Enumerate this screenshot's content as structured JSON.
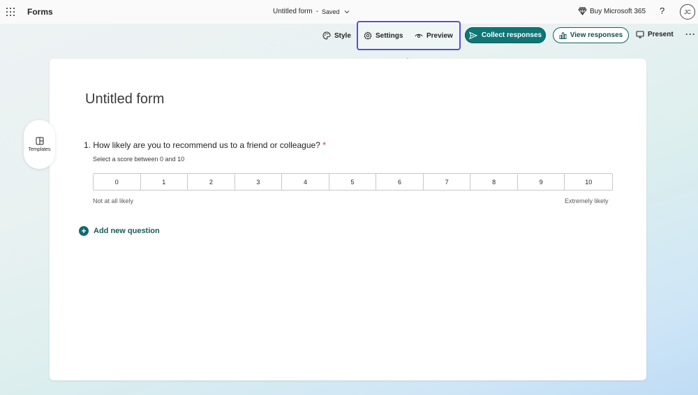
{
  "topbar": {
    "app_name": "Forms",
    "doc_title": "Untitled form",
    "separator": "-",
    "status": "Saved",
    "buy_label": "Buy Microsoft 365",
    "help_label": "?",
    "avatar_initials": "JC"
  },
  "toolbar": {
    "style_label": "Style",
    "settings_label": "Settings",
    "preview_label": "Preview",
    "collect_label": "Collect responses",
    "view_label": "View responses",
    "present_label": "Present",
    "more_label": "···"
  },
  "sidebar": {
    "templates_label": "Templates"
  },
  "form": {
    "title": "Untitled form",
    "question": {
      "number_text": "1. How likely are you to recommend us to a friend or colleague?",
      "required_marker": "*",
      "subtitle": "Select a score between 0 and 10",
      "scale": [
        "0",
        "1",
        "2",
        "3",
        "4",
        "5",
        "6",
        "7",
        "8",
        "9",
        "10"
      ],
      "low_label": "Not at all likely",
      "high_label": "Extremely likely"
    },
    "add_question_label": "Add new question",
    "add_question_glyph": "+"
  },
  "colors": {
    "accent_teal": "#0f7575",
    "highlight_purple": "#5b4fd1",
    "required_red": "#c4314b"
  },
  "icons": {
    "waffle": "app-launcher-icon",
    "chevron": "chevron-down-icon",
    "diamond": "diamond-icon",
    "palette": "palette-icon",
    "gear": "gear-icon",
    "eye": "eye-icon",
    "send": "send-icon",
    "chart": "chart-icon",
    "screen": "present-screen-icon",
    "templates": "templates-icon",
    "arrow": "arrow-up-icon",
    "plus": "plus-circle-icon"
  }
}
